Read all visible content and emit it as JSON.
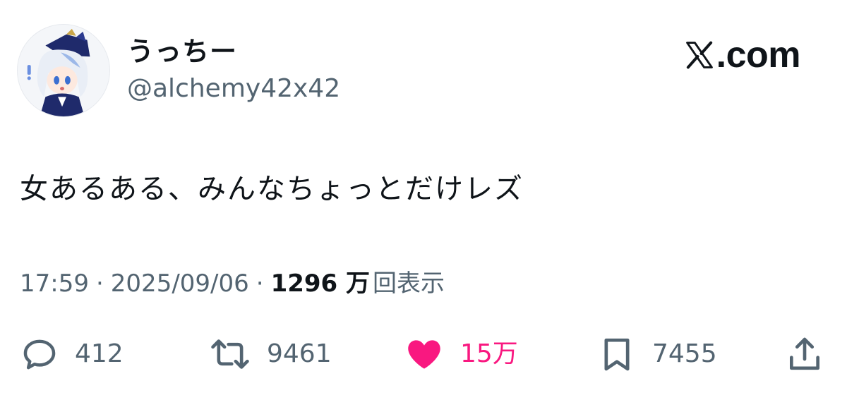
{
  "author": {
    "display_name": "うっちー",
    "handle": "@alchemy42x42",
    "avatar_icon": "anime-character-avatar-icon"
  },
  "site": {
    "logo_text": ".com",
    "logo_icon": "x-logo-icon"
  },
  "tweet": {
    "text": "女あるある、みんなちょっとだけレズ",
    "time": "17:59",
    "separator": "·",
    "date": "2025/09/06",
    "views_count": "1296 万",
    "views_label": "回表示"
  },
  "actions": {
    "reply": {
      "icon": "reply-icon",
      "count": "412"
    },
    "retweet": {
      "icon": "retweet-icon",
      "count": "9461"
    },
    "like": {
      "icon": "heart-icon",
      "count": "15万",
      "liked": true
    },
    "bookmark": {
      "icon": "bookmark-icon",
      "count": "7455"
    },
    "share": {
      "icon": "share-icon"
    }
  },
  "colors": {
    "text_primary": "#0f1419",
    "text_secondary": "#536471",
    "like_pink": "#f91880"
  }
}
